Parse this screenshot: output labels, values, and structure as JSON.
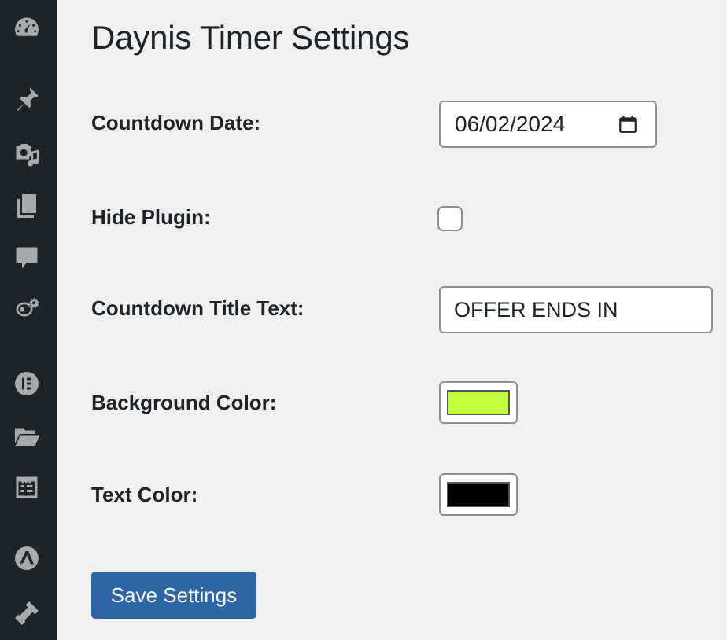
{
  "sidebar": {
    "items": [
      {
        "icon": "dashboard-icon"
      },
      {
        "icon": "pin-icon"
      },
      {
        "icon": "media-icon"
      },
      {
        "icon": "pages-icon"
      },
      {
        "icon": "comments-icon"
      },
      {
        "icon": "plugin-settings-icon"
      },
      {
        "icon": "elementor-icon"
      },
      {
        "icon": "folder-icon"
      },
      {
        "icon": "templates-icon"
      },
      {
        "icon": "astra-icon"
      },
      {
        "icon": "appearance-icon"
      }
    ]
  },
  "page": {
    "title": "Daynis Timer Settings"
  },
  "form": {
    "countdown_date": {
      "label": "Countdown Date:",
      "value": "06/02/2024"
    },
    "hide_plugin": {
      "label": "Hide Plugin:",
      "checked": false
    },
    "title_text": {
      "label": "Countdown Title Text:",
      "value": "OFFER ENDS IN"
    },
    "background_color": {
      "label": "Background Color:",
      "value": "#c3ff3a"
    },
    "text_color": {
      "label": "Text Color:",
      "value": "#000000"
    },
    "save_label": "Save Settings"
  },
  "colors": {
    "sidebar_bg": "#1d2327",
    "page_bg": "#f0f0f1",
    "button_bg": "#2e65a6"
  }
}
